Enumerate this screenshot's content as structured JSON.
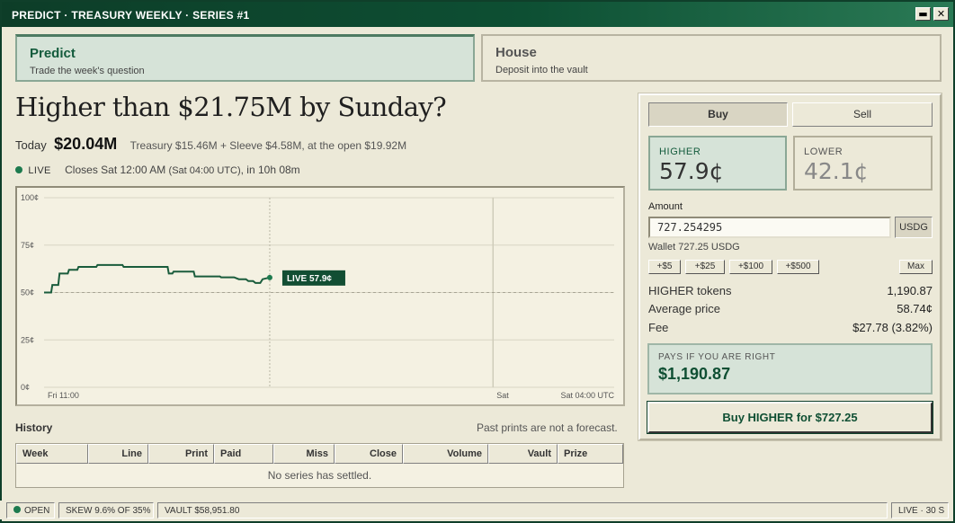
{
  "window": {
    "title": "PREDICT · TREASURY WEEKLY · SERIES #1",
    "minimize_glyph": "▬",
    "close_glyph": "✕"
  },
  "tabs": [
    {
      "title": "Predict",
      "subtitle": "Trade the week's question",
      "active": true
    },
    {
      "title": "House",
      "subtitle": "Deposit into the vault",
      "active": false
    }
  ],
  "market": {
    "question": "Higher than $21.75M by Sunday?",
    "today_label": "Today",
    "today_value": "$20.04M",
    "breakdown": "Treasury $15.46M + Sleeve $4.58M, at the open $19.92M",
    "live_label": "LIVE",
    "closes": "Closes Sat 12:00 AM",
    "closes_utc": "(Sat 04:00 UTC)",
    "closes_remaining": ", in 10h 08m"
  },
  "chart_data": {
    "type": "line",
    "y_ticks": [
      "100¢",
      "75¢",
      "50¢",
      "25¢",
      "0¢"
    ],
    "x_ticks": [
      "Fri 11:00",
      "Sat",
      "Sat 04:00 UTC"
    ],
    "ylim": [
      0,
      100
    ],
    "reference_line": 50,
    "live_label": "LIVE 57.9¢",
    "series": [
      {
        "x": [
          0,
          0.3,
          0.35,
          0.6,
          0.65,
          1.0,
          1.05,
          1.4,
          1.45,
          2.2,
          2.25,
          3.3,
          3.35,
          4.0,
          4.05,
          5.2,
          5.25,
          5.4,
          5.45,
          6.3,
          6.35,
          7.4,
          7.45,
          8.0,
          8.2,
          8.5,
          8.6,
          8.8,
          8.9,
          9.1,
          9.2,
          9.5
        ],
        "values": [
          50,
          50,
          54,
          54,
          60,
          60,
          62,
          62,
          63.5,
          63.5,
          64.5,
          64.5,
          63.5,
          63.5,
          63.5,
          63.5,
          60,
          60,
          61,
          61,
          58.5,
          58.5,
          58,
          58,
          57,
          57,
          56,
          56,
          55,
          55,
          57,
          57.9
        ]
      }
    ],
    "colors": {
      "line": "#1a5c3c",
      "grid": "#d8d5c4",
      "reference": "#a8a594"
    }
  },
  "history": {
    "title": "History",
    "note": "Past prints are not a forecast.",
    "columns": [
      "Week",
      "Line",
      "Print",
      "Paid",
      "Miss",
      "Close",
      "Volume",
      "Vault",
      "Prize"
    ],
    "empty": "No series has settled."
  },
  "trade": {
    "buy_label": "Buy",
    "sell_label": "Sell",
    "outcomes": [
      {
        "name": "HIGHER",
        "price": "57.9¢",
        "selected": true
      },
      {
        "name": "LOWER",
        "price": "42.1¢",
        "selected": false
      }
    ],
    "amount_label": "Amount",
    "amount_value": "727.254295",
    "currency": "USDG",
    "wallet": "Wallet 727.25 USDG",
    "quick_amounts": [
      "+$5",
      "+$25",
      "+$100",
      "+$500"
    ],
    "max_label": "Max",
    "stats": [
      {
        "label": "HIGHER tokens",
        "value": "1,190.87"
      },
      {
        "label": "Average price",
        "value": "58.74¢"
      },
      {
        "label": "Fee",
        "value": "$27.78 (3.82%)"
      }
    ],
    "pays_label": "PAYS IF YOU ARE RIGHT",
    "pays_value": "$1,190.87",
    "submit_label": "Buy HIGHER for $727.25"
  },
  "status": {
    "open": "OPEN",
    "skew": "SKEW 9.6% OF 35%",
    "vault": "VAULT $58,951.80",
    "live": "LIVE · 30 S"
  },
  "colors": {
    "accent": "#0f4f33",
    "title_bar": "#0d3d28",
    "live_dot": "#1d7a4e"
  }
}
